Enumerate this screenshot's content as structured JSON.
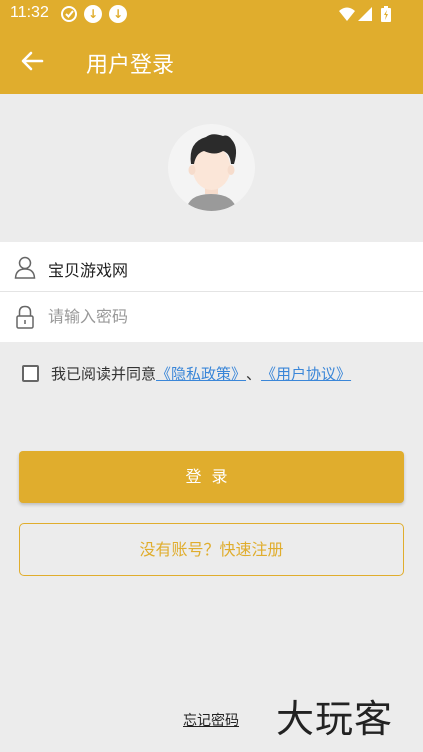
{
  "status_bar": {
    "time": "11:32",
    "icons": [
      "sync-badge-icon",
      "download-icon",
      "download-icon",
      "wifi-icon",
      "signal-icon",
      "battery-icon"
    ]
  },
  "app_bar": {
    "title": "用户登录",
    "back_icon": "arrow-left-icon"
  },
  "form": {
    "username_value": "宝贝游戏网",
    "password_placeholder": "请输入密码"
  },
  "agreement": {
    "text": "我已阅读并同意",
    "privacy_link": "《隐私政策》",
    "separator": "、",
    "user_agreement_link": "《用户协议》",
    "checked": false
  },
  "buttons": {
    "login": "登录",
    "register": "没有账号？快速注册",
    "forgot": "忘记密码"
  },
  "watermark": "大玩客",
  "colors": {
    "accent": "#e0ad2d",
    "background": "#ececec",
    "link": "#3a86d8"
  }
}
